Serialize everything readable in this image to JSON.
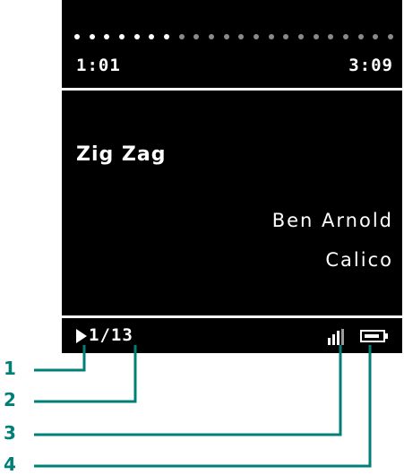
{
  "player": {
    "progress": {
      "fraction": 0.32,
      "played_color": "#ffffff",
      "remaining_color": "#8a8a8a",
      "dots": 22
    },
    "elapsed": "1:01",
    "total": "3:09",
    "title": "Zig Zag",
    "artist": "Ben Arnold",
    "album": "Calico",
    "track": "1/13",
    "status_icons": {
      "state": "play-icon",
      "signal": "signal-icon",
      "battery": "battery-icon"
    }
  },
  "callouts": {
    "color": "#007f78",
    "labels": [
      "1",
      "2",
      "3",
      "4"
    ]
  }
}
